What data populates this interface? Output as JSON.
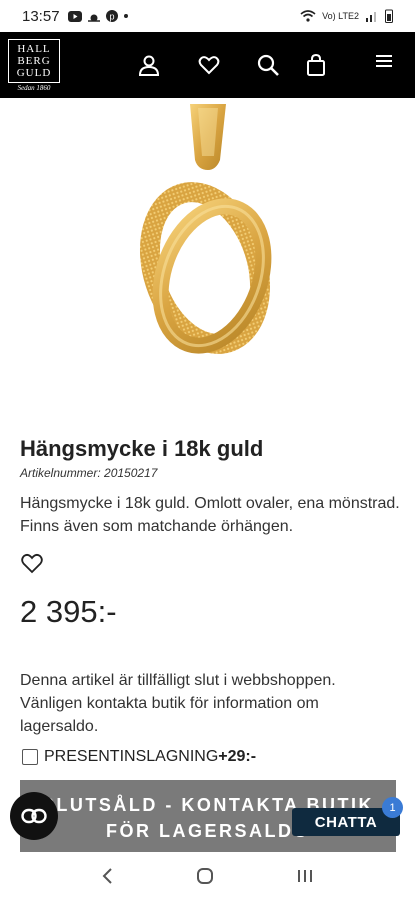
{
  "status": {
    "time": "13:57",
    "network": "Vo) LTE2"
  },
  "brand": {
    "line1": "HALL",
    "line2": "BERG",
    "line3": "GULD",
    "sedan": "Sedan 1860"
  },
  "icons": {
    "account": "user-icon",
    "wishlist": "heart-icon",
    "search": "search-icon",
    "cart": "bag-icon",
    "menu": "hamburger-icon"
  },
  "product": {
    "title": "Hängsmycke i 18k guld",
    "article_number": "Artikelnummer: 20150217",
    "description": "Hängsmycke i 18k guld. Omlott ovaler, ena mönstrad. Finns även som matchande örhängen.",
    "price": "2 395:-",
    "notice": "Denna artikel är tillfälligt slut i webbshoppen. Vänligen kontakta butik för information om lagersaldo.",
    "gift_label": "PRESENTINSLAGNING",
    "gift_price": "+29:-",
    "soldout_line1": "SLUTSÅLD - KONTAKTA BUTIK",
    "soldout_line2": "FÖR LAGERSALDO"
  },
  "chat": {
    "label": "CHATTA",
    "badge": "1"
  },
  "colors": {
    "gold": "#d9a441",
    "header": "#000000",
    "soldout": "#7a7a7a",
    "chat": "#0f2a3f",
    "badge": "#3a7bd5"
  }
}
